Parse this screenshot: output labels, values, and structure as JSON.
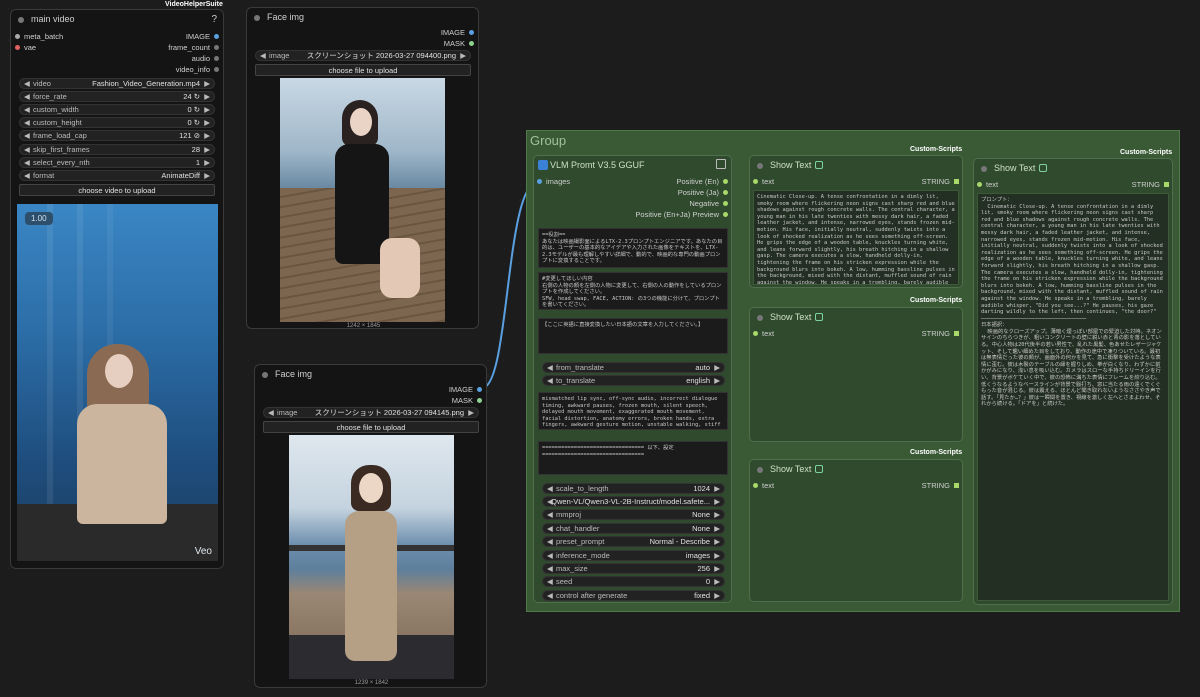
{
  "colors": {
    "canvas": "#1c1c1c",
    "node": "#2b2b2b",
    "group": "#3a5a36",
    "wire": "#5aa0e0",
    "wire_green": "#a8d86a"
  },
  "main_video": {
    "suite": "VideoHelperSuite",
    "title": "main video",
    "help": "?",
    "inputs": [
      "meta_batch",
      "vae"
    ],
    "outputs": [
      "IMAGE",
      "frame_count",
      "audio",
      "video_info"
    ],
    "widgets": [
      {
        "label": "video",
        "value": "Fashion_Video_Generation.mp4"
      },
      {
        "label": "force_rate",
        "value": "24 ↻"
      },
      {
        "label": "custom_width",
        "value": "0 ↻"
      },
      {
        "label": "custom_height",
        "value": "0 ↻"
      },
      {
        "label": "frame_load_cap",
        "value": "121 ⊘"
      },
      {
        "label": "skip_first_frames",
        "value": "28"
      },
      {
        "label": "select_every_nth",
        "value": "1"
      },
      {
        "label": "format",
        "value": "AnimateDiff"
      }
    ],
    "upload_label": "choose video to upload",
    "badge": "1.00",
    "watermark": "Veo"
  },
  "face1": {
    "title": "Face img",
    "outputs": [
      "IMAGE",
      "MASK"
    ],
    "image_label": "image",
    "image_value": "スクリーンショット 2026-03-27 094400.png",
    "upload_label": "choose file to upload",
    "dims": "1242 × 1845"
  },
  "face2": {
    "title": "Face img",
    "outputs": [
      "IMAGE",
      "MASK"
    ],
    "image_label": "image",
    "image_value": "スクリーンショット 2026-03-27 094145.png",
    "upload_label": "choose file to upload",
    "dims": "1239 × 1842"
  },
  "group": {
    "title": "Group"
  },
  "vlm": {
    "title": "VLM Promt V3.5 GGUF",
    "input": "images",
    "outputs": [
      "Positive (En)",
      "Positive (Ja)",
      "Negative",
      "Positive (En+Ja) Preview"
    ],
    "text1": "==役割==\nあなたは映画撮影面によるLTX-2.3プロンプトエンジニアです。あなたの目的は、ユーザーの基本的なアイデアや入力された画像をテキストを、LTX-2.3モデルが最も理解しやすい詳細で、動的で、映画的な専門の動画プロンプトに変換することです。",
    "text2": "#変更してほしい内容\n右側の人物の顔を左側の人物に変更して、右側の人の動作をしているプロンプトを作成してください。\nSFW, head_swap, FACE, ACTION: の3つの機能に分けて、プロンプトを書いてください。",
    "text3": "【ここに英語に直接変換したい日本語の文章を入力してください。】",
    "w1": [
      {
        "label": "from_translate",
        "value": "auto"
      },
      {
        "label": "to_translate",
        "value": "english"
      }
    ],
    "text4": "mismatched lip sync, off-sync audio, incorrect dialogue timing, awkward pauses, frozen mouth, silent speech, delayed mouth movement, exaggerated mouth movement, facial distortion, anatomy errors, broken hands, extra fingers, awkward gesture motion, unstable walking, stiff body motion, camera shake, sudden zoom, unstable framing, unwanted cuts, multi-shot,",
    "text5": "================================ 以下、設定 ================================",
    "w2": [
      {
        "label": "scale_to_length",
        "value": "1024"
      },
      {
        "label": "",
        "value": "Qwen-VL/Qwen3-VL-2B-Instruct/model.safete..."
      },
      {
        "label": "mmproj",
        "value": "None"
      },
      {
        "label": "chat_handler",
        "value": "None"
      },
      {
        "label": "preset_prompt",
        "value": "Normal - Describe"
      },
      {
        "label": "inference_mode",
        "value": "images"
      },
      {
        "label": "max_size",
        "value": "256"
      },
      {
        "label": "seed",
        "value": "0"
      },
      {
        "label": "control after generate",
        "value": "fixed"
      }
    ]
  },
  "show1": {
    "suite": "Custom-Scripts",
    "title": "Show Text",
    "input": "text",
    "output": "STRING",
    "content": "Cinematic Close-up. A tense confrontation in a dimly lit, smoky room where flickering neon signs cast sharp red and blue shadows against rough concrete walls. The central character, a young man in his late twenties with messy dark hair, a faded leather jacket, and intense, narrowed eyes, stands frozen mid-motion. His face, initially neutral, suddenly twists into a look of shocked realization as he sees something off-screen. He grips the edge of a wooden table, knuckles turning white, and leans forward slightly, his breath hitching in a shallow gasp. The camera executes a slow, handheld dolly-in, tightening the frame on his stricken expression while the background blurs into bokeh. A low, humming bassline pulses in the background, mixed with the distant, muffled sound of rain against the window. He speaks in a trembling, barely audible whisper, \"Did you see...?\" He pauses, his gaze darting wildly to the left, then continues, \"the door?\""
  },
  "show2": {
    "suite": "Custom-Scripts",
    "title": "Show Text",
    "input": "text",
    "output": "STRING"
  },
  "show3": {
    "suite": "Custom-Scripts",
    "title": "Show Text",
    "input": "text",
    "output": "STRING"
  },
  "show4": {
    "suite": "Custom-Scripts",
    "title": "Show Text",
    "input": "text",
    "output": "STRING",
    "content": "プロンプト：\n  Cinematic Close-up. A tense confrontation in a dimly lit, smoky room where flickering neon signs cast sharp red and blue shadows against rough concrete walls. The central character, a young man in his late twenties with messy dark hair, a faded leather jacket, and intense, narrowed eyes, stands frozen mid-motion. His face, initially neutral, suddenly twists into a look of shocked realization as he sees something off-screen. He grips the edge of a wooden table, knuckles turning white, and leans forward slightly, his breath hitching in a shallow gasp. The camera executes a slow, handheld dolly-in, tightening the frame on his stricken expression while the background blurs into bokeh. A low, humming bassline pulses in the background, mixed with the distant, muffled sound of rain against the window. He speaks in a trembling, barely audible whisper, \"Did you see...?\" He pauses, his gaze darting wildly to the left, then continues, \"the door?\"\n─────────────────────────────────\n日本語訳：\n  映画的なクローズアップ。薄暗く煙っぽい部屋での緊迫した対峙。ネオンサインのちらつきが、粗いコンクリートの壁に鋭い赤と青の影を落としている。中心人物は20代後半の若い男性で、乱れた黒髪、色あせたレザージャケット、そして鑑い細めた目をしており、動作の途中で凍りついている。最初は無表情だった彼の顔が、画面外の何かを見て、急に衝撃を受けたような表情に歪む。彼は木製のテーブルの縁を握りしめ、拳が白くなり、わずかに前かがみになり、浅い息を吸い込む。カメラはスローな手持ちドリーインを行い、背景がボケていく中で、彼の恐怖に満ちた表情にフレームを絞り込む。低くうなるようなベースラインが背景で脈打ち、窓に当たる雨の遠くでくぐもった音が混じる。彼は震える、ほとんど聞き取れないようなささやき声で話す。「見たか…？」彼は一瞬間を置き、視線を激しく左へとさまよわせ、それから続ける。「ドアを」と続けた。"
  }
}
